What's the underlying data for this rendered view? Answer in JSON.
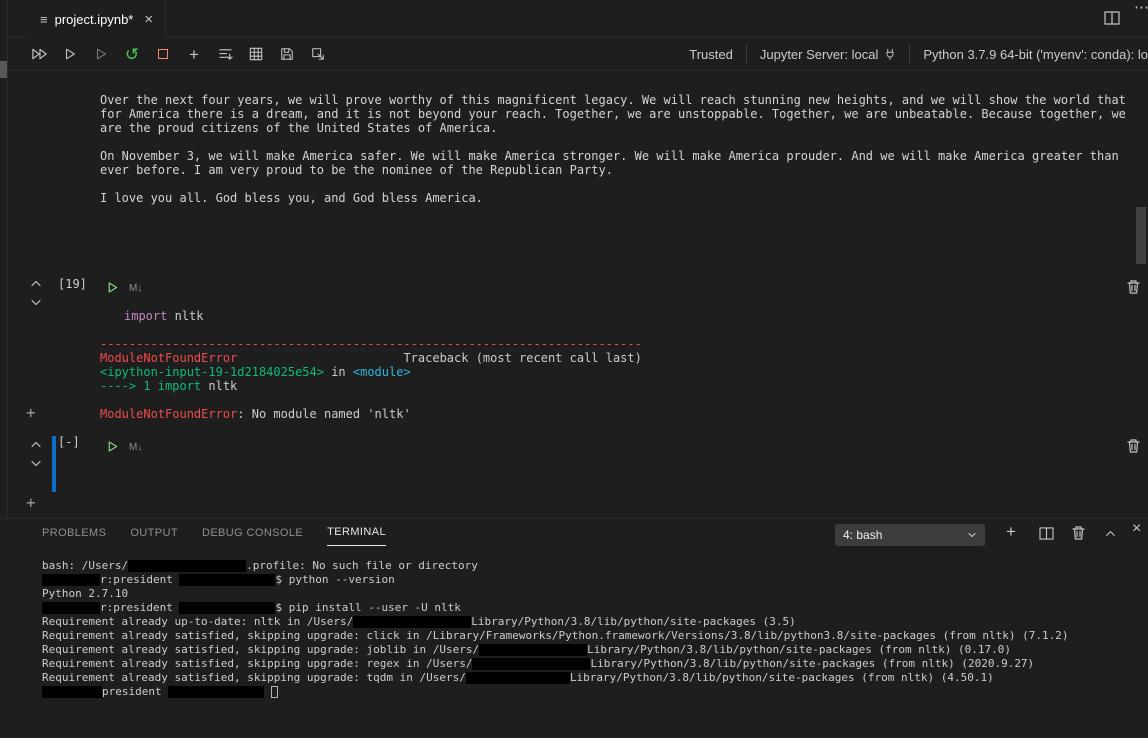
{
  "colors": {
    "accent": "#0e70c0",
    "error_red": "#f14c4c",
    "ansi_green": "#0dbc79",
    "ansi_cyan": "#29b8db",
    "keyword_magenta": "#c586c0",
    "run_green": "#89d185",
    "restart_green": "#4ec94e",
    "stop_red": "#f48771",
    "redaction": "#000000"
  },
  "tab_bar": {
    "file_icon_glyph": "≡",
    "tab_title": "project.ipynb*",
    "close_glyph": "×",
    "more_actions_glyph": "⋯"
  },
  "toolbar": {
    "restart_glyph": "↺",
    "add_glyph": "+",
    "status": {
      "trusted": "Trusted",
      "jupyter_server": "Jupyter Server: local",
      "python_interpreter": "Python 3.7.9 64-bit ('myenv': conda): lo"
    }
  },
  "notebook": {
    "add_cell_glyph": "+",
    "output_paragraphs": [
      "Over the next four years, we will prove worthy of this magnificent legacy. We will reach stunning new heights, and we will show the world that for America there is a dream, and it is not beyond your reach. Together, we are unstoppable. Together, we are unbeatable. Because together, we are the proud citizens of the United States of America.",
      "On November 3, we will make America safer. We will make America stronger. We will make America prouder. And we will make America greater than ever before. I am very proud to be the nominee of the Republican Party.",
      "I love you all. God bless you, and God bless America."
    ],
    "cells": [
      {
        "execution_count": "[19]",
        "lang_glyph": "M↓",
        "code": [
          {
            "text": "import",
            "cls": "kw"
          },
          {
            "text": " nltk",
            "cls": "pl"
          }
        ],
        "error_lines": [
          [
            {
              "text": "---------------------------------------------------------------------------",
              "cls": "err"
            }
          ],
          [
            {
              "text": "ModuleNotFoundError",
              "cls": "err"
            },
            {
              "text": "                       Traceback (most recent call last)",
              "cls": "pl"
            }
          ],
          [
            {
              "text": "<ipython-input-19-1d2184025e54>",
              "cls": "grn"
            },
            {
              "text": " in ",
              "cls": "pl"
            },
            {
              "text": "<module>",
              "cls": "cyn"
            }
          ],
          [
            {
              "text": "----> 1 ",
              "cls": "grn"
            },
            {
              "text": "import",
              "cls": "grn"
            },
            {
              "text": " nltk",
              "cls": "pl"
            }
          ],
          [],
          [
            {
              "text": "ModuleNotFoundError",
              "cls": "err"
            },
            {
              "text": ": No module named 'nltk'",
              "cls": "pl"
            }
          ]
        ]
      },
      {
        "execution_count": "[-]",
        "lang_glyph": "M↓",
        "code": [],
        "error_lines": []
      }
    ]
  },
  "panel": {
    "tabs": [
      {
        "label": "PROBLEMS",
        "active": false
      },
      {
        "label": "OUTPUT",
        "active": false
      },
      {
        "label": "DEBUG CONSOLE",
        "active": false
      },
      {
        "label": "TERMINAL",
        "active": true
      }
    ],
    "terminal_selector_value": "4: bash",
    "add_glyph": "+",
    "close_glyph": "×",
    "terminal_lines": [
      [
        {
          "text": "bash: /Users/"
        },
        {
          "redact": 118
        },
        {
          "text": ".profile: No such file or directory"
        }
      ],
      [
        {
          "redact": 58
        },
        {
          "text": "r:president "
        },
        {
          "redact": 96
        },
        {
          "text": "$ python --version"
        }
      ],
      [
        {
          "text": "Python 2.7.10"
        }
      ],
      [
        {
          "redact": 58
        },
        {
          "text": "r:president "
        },
        {
          "redact": 96
        },
        {
          "text": "$ pip install --user -U nltk"
        }
      ],
      [
        {
          "text": "Requirement already up-to-date: nltk in /Users/"
        },
        {
          "redact": 118
        },
        {
          "text": "Library/Python/3.8/lib/python/site-packages (3.5)"
        }
      ],
      [
        {
          "text": "Requirement already satisfied, skipping upgrade: click in /Library/Frameworks/Python.framework/Versions/3.8/lib/python3.8/site-packages (from nltk) (7.1.2)"
        }
      ],
      [
        {
          "text": "Requirement already satisfied, skipping upgrade: joblib in /Users/"
        },
        {
          "redact": 108
        },
        {
          "text": "Library/Python/3.8/lib/python/site-packages (from nltk) (0.17.0)"
        }
      ],
      [
        {
          "text": "Requirement already satisfied, skipping upgrade: regex in /Users/"
        },
        {
          "redact": 118
        },
        {
          "text": "Library/Python/3.8/lib/python/site-packages (from nltk) (2020.9.27)"
        }
      ],
      [
        {
          "text": "Requirement already satisfied, skipping upgrade: tqdm in /Users/"
        },
        {
          "redact": 104
        },
        {
          "text": "Library/Python/3.8/lib/python/site-packages (from nltk) (4.50.1)"
        }
      ],
      [
        {
          "redact": 60
        },
        {
          "text": "president "
        },
        {
          "redact": 96
        },
        {
          "text": " "
        },
        {
          "cursor": true
        }
      ]
    ]
  }
}
